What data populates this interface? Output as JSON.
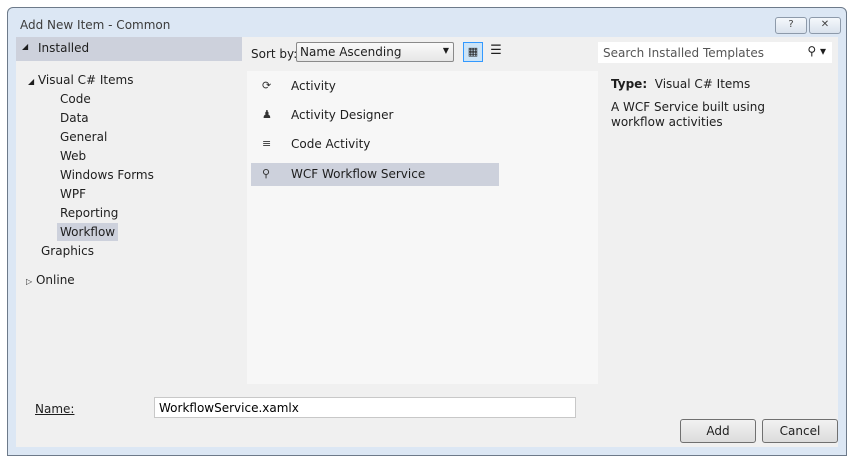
{
  "window": {
    "title": "Add New Item - Common",
    "help": "?",
    "close": "✕"
  },
  "left": {
    "installed": "Installed",
    "visual_cs": "Visual C# Items",
    "children": [
      "Code",
      "Data",
      "General",
      "Web",
      "Windows Forms",
      "WPF",
      "Reporting",
      "Workflow"
    ],
    "graphics": "Graphics",
    "online": "Online"
  },
  "toolbar": {
    "sort_label": "Sort by:",
    "sort_value": "Name Ascending"
  },
  "templates": [
    {
      "icon": "⟳",
      "label": "Activity"
    },
    {
      "icon": "♟",
      "label": "Activity Designer"
    },
    {
      "icon": "≡",
      "label": "Code Activity"
    },
    {
      "icon": "⚲",
      "label": "WCF Workflow Service"
    }
  ],
  "search": {
    "placeholder": "Search Installed Templates"
  },
  "details": {
    "type_label": "Type:",
    "type_value": "Visual C# Items",
    "description": "A WCF Service built using workflow activities"
  },
  "name": {
    "label": "Name:",
    "value": "WorkflowService.xamlx"
  },
  "buttons": {
    "add": "Add",
    "cancel": "Cancel"
  }
}
